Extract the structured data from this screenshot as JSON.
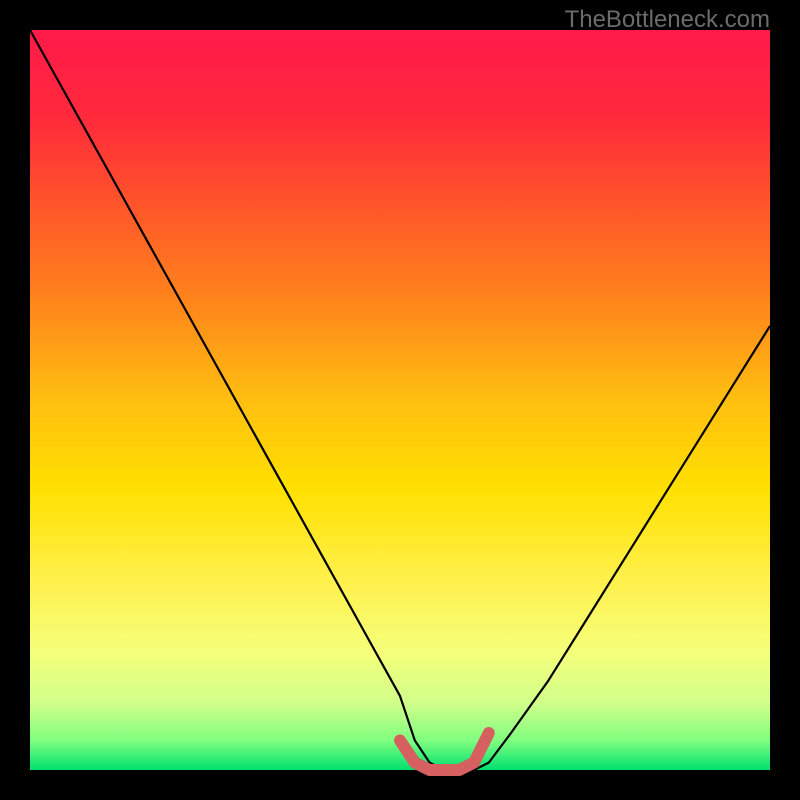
{
  "watermark": "TheBottleneck.com",
  "chart_data": {
    "type": "line",
    "title": "",
    "xlabel": "",
    "ylabel": "",
    "xlim": [
      0,
      100
    ],
    "ylim": [
      0,
      100
    ],
    "x": [
      0,
      5,
      10,
      15,
      20,
      25,
      30,
      35,
      40,
      45,
      50,
      52,
      54,
      56,
      58,
      60,
      62,
      65,
      70,
      75,
      80,
      85,
      90,
      95,
      100
    ],
    "values": [
      100,
      91,
      82,
      73,
      64,
      55,
      46,
      37,
      28,
      19,
      10,
      4,
      1,
      0,
      0,
      0,
      1,
      5,
      12,
      20,
      28,
      36,
      44,
      52,
      60
    ],
    "gradient_stops": [
      {
        "offset": 0.0,
        "color": "#ff1a4a"
      },
      {
        "offset": 0.12,
        "color": "#ff2a3a"
      },
      {
        "offset": 0.25,
        "color": "#ff5a28"
      },
      {
        "offset": 0.38,
        "color": "#ff8a1a"
      },
      {
        "offset": 0.5,
        "color": "#ffbf10"
      },
      {
        "offset": 0.62,
        "color": "#ffe000"
      },
      {
        "offset": 0.74,
        "color": "#fff04a"
      },
      {
        "offset": 0.84,
        "color": "#f5ff7a"
      },
      {
        "offset": 0.91,
        "color": "#d0ff8a"
      },
      {
        "offset": 0.96,
        "color": "#80ff80"
      },
      {
        "offset": 1.0,
        "color": "#00e070"
      }
    ],
    "marker_region": {
      "color": "#d66060",
      "x": [
        50,
        52,
        54,
        56,
        58,
        60,
        62
      ],
      "values": [
        4,
        1,
        0,
        0,
        0,
        1,
        5
      ]
    }
  }
}
